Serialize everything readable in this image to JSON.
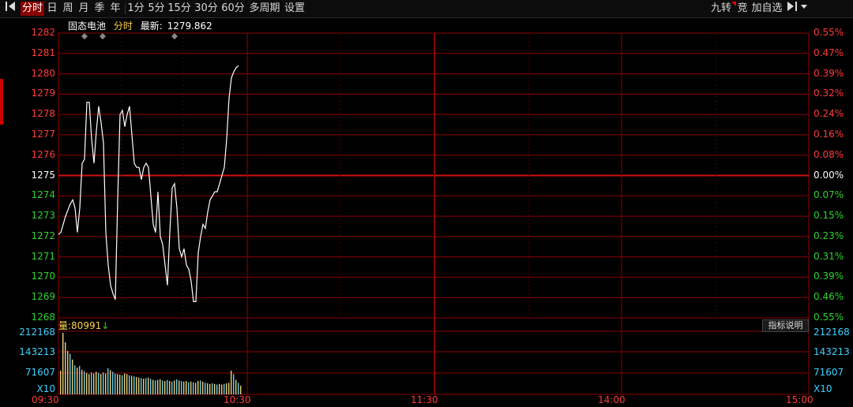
{
  "toolbar": {
    "left_items": [
      {
        "label": "分时",
        "active": true
      },
      {
        "label": "日"
      },
      {
        "label": "周"
      },
      {
        "label": "月"
      },
      {
        "label": "季"
      },
      {
        "label": "年"
      },
      {
        "label": "1分"
      },
      {
        "label": "5分"
      },
      {
        "label": "15分"
      },
      {
        "label": "30分"
      },
      {
        "label": "60分"
      },
      {
        "label": "多周期"
      },
      {
        "label": "设置"
      }
    ],
    "right_items": [
      "九转",
      "竞",
      "加自选"
    ]
  },
  "info": {
    "name": "固态电池",
    "period": "分时",
    "latest_label": "最新:",
    "latest_value": "1279.862"
  },
  "volume_info": {
    "label": "量:",
    "value": "80991",
    "arrow": "↓"
  },
  "indicator_button": "指标说明",
  "colors": {
    "background": "#000000",
    "grid": "#8b0000",
    "up": "#ff3b3b",
    "down": "#2fd32f",
    "price_line": "#ffffff",
    "volume_label": "#40d0ff"
  },
  "chart_data": {
    "type": "line",
    "baseline": 1275,
    "ylim": [
      1268,
      1282
    ],
    "left_ticks": [
      "1282",
      "1281",
      "1280",
      "1279",
      "1278",
      "1277",
      "1276",
      "1275",
      "1274",
      "1273",
      "1272",
      "1271",
      "1270",
      "1269",
      "1268"
    ],
    "right_ticks": [
      "0.55%",
      "0.47%",
      "0.39%",
      "0.32%",
      "0.24%",
      "0.16%",
      "0.08%",
      "0.00%",
      "0.07%",
      "0.15%",
      "0.23%",
      "0.31%",
      "0.39%",
      "0.46%",
      "0.55%"
    ],
    "x_ticks": [
      "09:30",
      "10:30",
      "11:30",
      "14:00",
      "15:00"
    ],
    "series": [
      {
        "values": [
          1272.1,
          1272.2,
          1272.6,
          1273.0,
          1273.3,
          1273.6,
          1273.8,
          1273.4,
          1272.2,
          1273.4,
          1275.6,
          1275.8,
          1278.6,
          1278.6,
          1276.8,
          1275.6,
          1277.2,
          1278.4,
          1277.6,
          1276.6,
          1272.2,
          1270.6,
          1269.6,
          1269.2,
          1268.9,
          1273.8,
          1278.0,
          1278.2,
          1277.4,
          1278.0,
          1278.4,
          1277.0,
          1275.6,
          1275.4,
          1275.4,
          1274.8,
          1275.4,
          1275.6,
          1275.4,
          1274.0,
          1272.6,
          1272.2,
          1274.2,
          1272.0,
          1271.6,
          1270.6,
          1269.6,
          1272.2,
          1274.4,
          1274.6,
          1273.4,
          1271.4,
          1271.0,
          1271.4,
          1270.6,
          1270.4,
          1269.8,
          1268.8,
          1268.8,
          1271.2,
          1272.0,
          1272.6,
          1272.4,
          1273.2,
          1273.8,
          1274.0,
          1274.2,
          1274.2,
          1274.6,
          1275.0,
          1275.4,
          1276.8,
          1278.8,
          1279.8,
          1280.1,
          1280.3,
          1280.4
        ]
      }
    ],
    "volume": {
      "ylim": [
        0,
        212168
      ],
      "ticks": [
        "212168",
        "143213",
        "71607",
        "X10"
      ],
      "latest": "80991",
      "values": [
        82000,
        212168,
        180000,
        150000,
        140000,
        120000,
        100000,
        92000,
        98000,
        85000,
        80000,
        74000,
        70000,
        76000,
        72000,
        78000,
        74000,
        70000,
        76000,
        72000,
        90000,
        84000,
        78000,
        72000,
        70000,
        68000,
        66000,
        72000,
        70000,
        66000,
        64000,
        62000,
        60000,
        58000,
        56000,
        54000,
        56000,
        58000,
        54000,
        50000,
        48000,
        50000,
        52000,
        48000,
        46000,
        50000,
        46000,
        44000,
        48000,
        52000,
        48000,
        46000,
        44000,
        46000,
        42000,
        44000,
        42000,
        40000,
        46000,
        48000,
        44000,
        40000,
        38000,
        36000,
        38000,
        36000,
        34000,
        36000,
        34000,
        36000,
        38000,
        40000,
        82000,
        70000,
        50000,
        40000,
        30000
      ],
      "colors": [
        "y",
        "y",
        "y",
        "y",
        "c",
        "y",
        "c",
        "y",
        "c",
        "y",
        "c",
        "y",
        "y",
        "c",
        "y",
        "y",
        "c",
        "y",
        "c",
        "y",
        "c",
        "y",
        "c",
        "c",
        "y",
        "y",
        "c",
        "y",
        "y",
        "c",
        "y",
        "c",
        "y",
        "y",
        "c",
        "y",
        "c",
        "y",
        "c",
        "y",
        "c",
        "y",
        "y",
        "c",
        "y",
        "c",
        "y",
        "c",
        "y",
        "c",
        "y",
        "c",
        "y",
        "y",
        "c",
        "y",
        "c",
        "y",
        "y",
        "c",
        "y",
        "c",
        "y",
        "y",
        "c",
        "y",
        "c",
        "y",
        "y",
        "c",
        "y",
        "y",
        "y",
        "c",
        "y",
        "c",
        "y"
      ]
    }
  }
}
